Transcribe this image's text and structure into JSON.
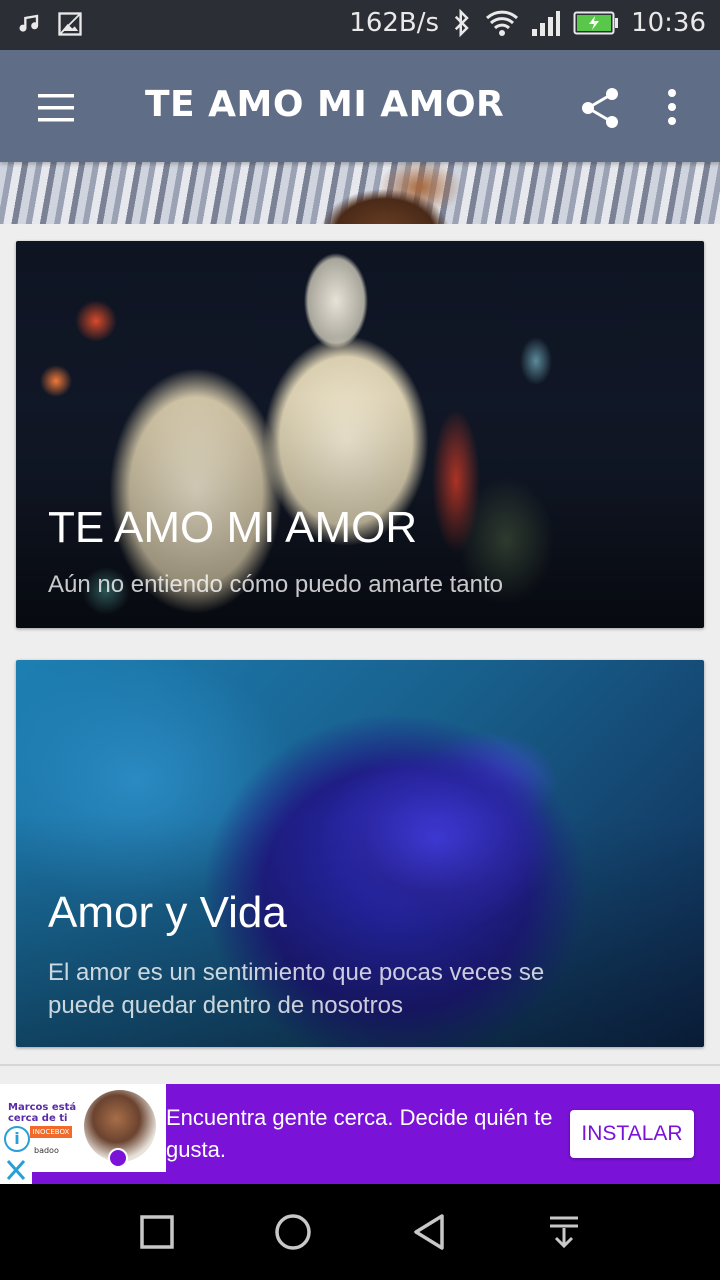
{
  "status_bar": {
    "net_speed": "162B/s",
    "time": "10:36",
    "icons": [
      "music-icon",
      "image-icon",
      "bluetooth-icon",
      "wifi-icon",
      "signal-icon",
      "battery-charging-icon"
    ]
  },
  "app_bar": {
    "title": "TE AMO MI AMOR",
    "menu_icon": "hamburger-menu-icon",
    "share_icon": "share-icon",
    "more_icon": "more-vert-icon"
  },
  "cards": [
    {
      "title": "TE AMO MI AMOR",
      "subtitle": "Aún no entiendo cómo puedo amarte tanto"
    },
    {
      "title": "Amor y Vida",
      "subtitle": " El amor es un sentimiento que pocas veces se\npuede quedar dentro de nosotros"
    }
  ],
  "ad": {
    "promo_text": "Marcos está cerca de ti",
    "promo_badge": "INOCEBOX",
    "brand": "badoo",
    "headline": "Encuentra gente cerca. Decide quién te gusta.",
    "cta": "INSTALAR",
    "accent": "#7a12d8"
  },
  "nav_bar": {
    "icons": [
      "recents-square-icon",
      "home-circle-icon",
      "back-triangle-icon",
      "notification-pull-icon"
    ]
  }
}
